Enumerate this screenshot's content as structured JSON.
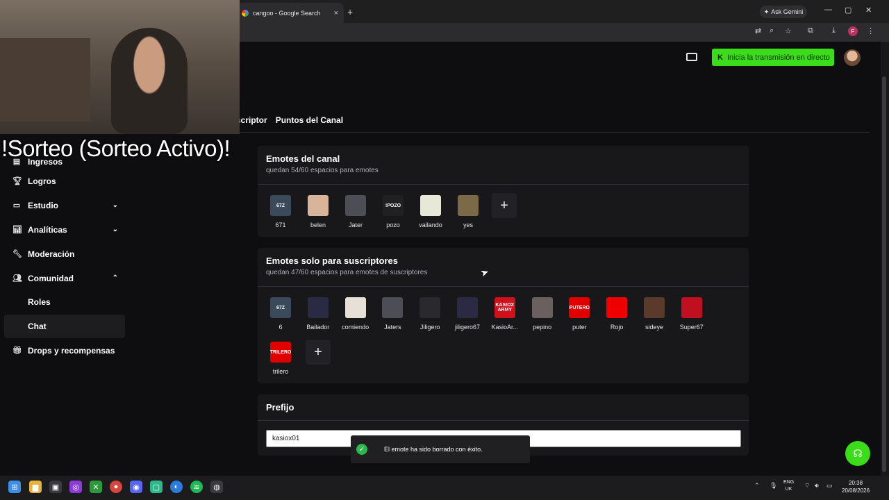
{
  "browser": {
    "tab_title": "cangoo - Google Search",
    "tab_close": "×",
    "new_tab": "+",
    "gemini_label": "Ask Gemini",
    "minimize": "—",
    "maximize": "▢",
    "close": "✕",
    "profile_initial": "F"
  },
  "header": {
    "live_button": "Inicia la transmisión en directo"
  },
  "overlay": {
    "sorteo_text": "!Sorteo (Sorteo Activo)!"
  },
  "tabs": [
    "scriptor",
    "Puntos del Canal"
  ],
  "sidebar": {
    "items": [
      {
        "label": "Logros",
        "icon": "trophy-icon"
      },
      {
        "label": "Estudio",
        "icon": "studio-icon",
        "chevron": "⌄"
      },
      {
        "label": "Analíticas",
        "icon": "analytics-icon",
        "chevron": "⌄"
      },
      {
        "label": "Moderación",
        "icon": "wrench-icon"
      },
      {
        "label": "Comunidad",
        "icon": "users-icon",
        "chevron": "⌃"
      }
    ],
    "subitems": [
      "Roles",
      "Chat"
    ],
    "bottom_item": {
      "label": "Drops y recompensas",
      "icon": "gift-icon"
    },
    "partial_label": "Ingresos"
  },
  "channel_emotes": {
    "title": "Emotes del canal",
    "subtitle": "quedan 54/60 espacios para emotes",
    "emotes": [
      {
        "name": "671",
        "thumb": "67Z",
        "color": "#3a4a5a"
      },
      {
        "name": "belen",
        "thumb": "",
        "color": "#d8b49a"
      },
      {
        "name": "Jater",
        "thumb": "",
        "color": "#4d4d55"
      },
      {
        "name": "pozo",
        "thumb": "!POZO",
        "color": "#202022"
      },
      {
        "name": "vailando",
        "thumb": "",
        "color": "#e8e8d8"
      },
      {
        "name": "yes",
        "thumb": "",
        "color": "#7a6a48"
      }
    ]
  },
  "sub_emotes": {
    "title": "Emotes solo para suscriptores",
    "subtitle": "quedan 47/60 espacios para emotes de suscriptores",
    "emotes": [
      {
        "name": "6",
        "thumb": "67Z",
        "color": "#3a4a5a"
      },
      {
        "name": "Bailador",
        "thumb": "",
        "color": "#2a2a44"
      },
      {
        "name": "comiendo",
        "thumb": "",
        "color": "#e6e0d6"
      },
      {
        "name": "Jaters",
        "thumb": "",
        "color": "#4d4d55"
      },
      {
        "name": "Jiligero",
        "thumb": "",
        "color": "#2a2a2e"
      },
      {
        "name": "jiligero67",
        "thumb": "",
        "color": "#2a2a44"
      },
      {
        "name": "KasioAr...",
        "thumb": "KASIOX ARMY",
        "color": "#d0101a"
      },
      {
        "name": "pepino",
        "thumb": "",
        "color": "#6a6060"
      },
      {
        "name": "puter",
        "thumb": "PUTERO",
        "color": "#e00000"
      },
      {
        "name": "Rojo",
        "thumb": "",
        "color": "#ee0000"
      },
      {
        "name": "sideye",
        "thumb": "",
        "color": "#5a3a2a"
      },
      {
        "name": "Super67",
        "thumb": "",
        "color": "#c01020"
      },
      {
        "name": "trilero",
        "thumb": "TRILERO",
        "color": "#e00000"
      }
    ]
  },
  "prefix": {
    "title": "Prefijo",
    "value": "kasiox01"
  },
  "toast": {
    "message": "El emote ha sido borrado con éxito."
  },
  "taskbar": {
    "lang_top": "ENG",
    "lang_bottom": "UK",
    "time": "20:38",
    "date": "20/08/2026"
  }
}
